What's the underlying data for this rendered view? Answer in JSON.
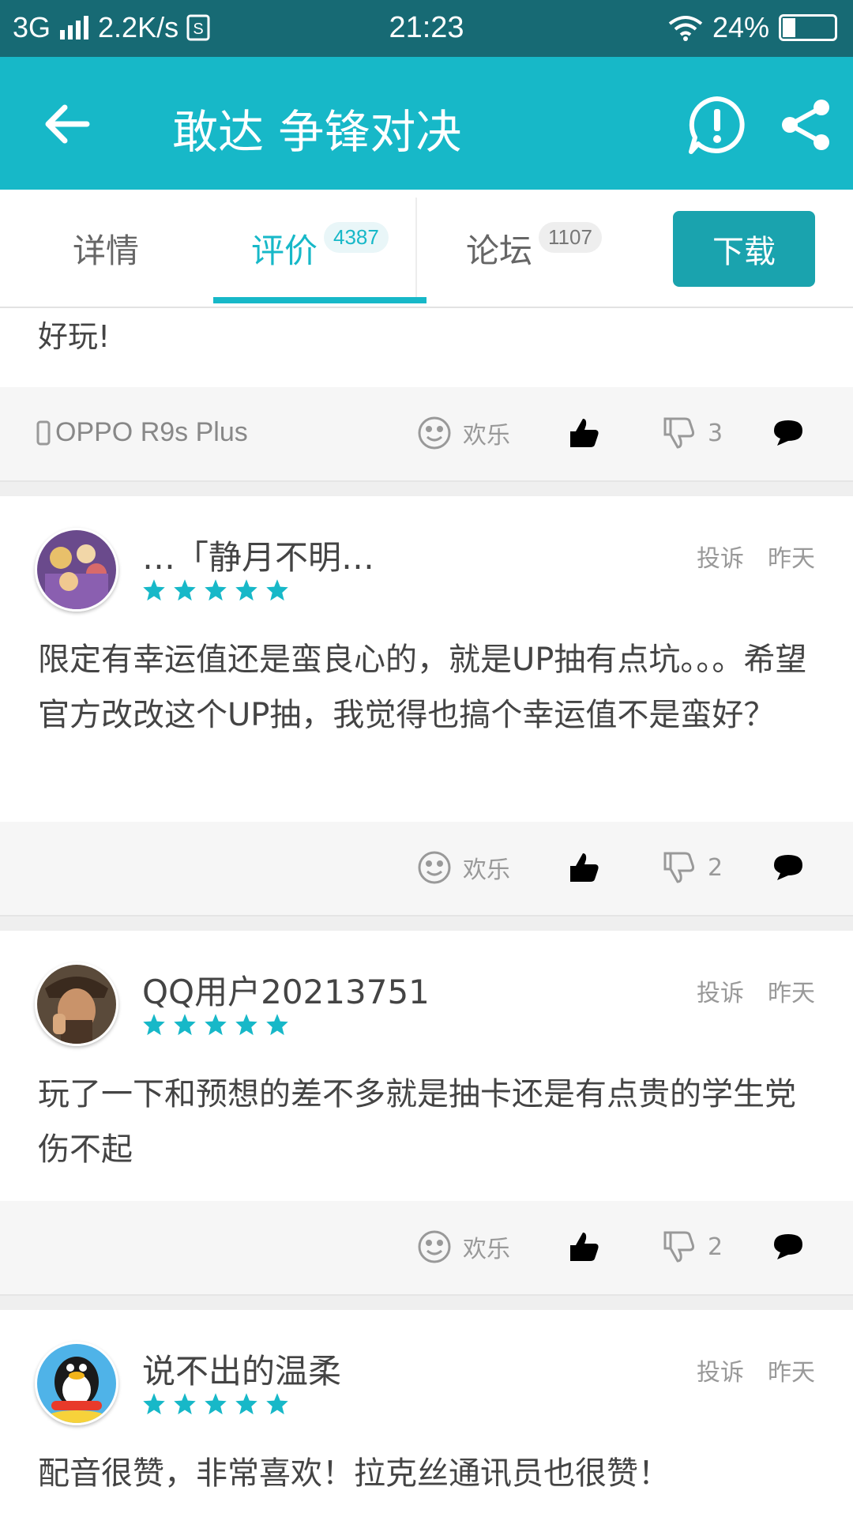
{
  "status": {
    "network": "3G",
    "speed": "2.2K/s",
    "time": "21:23",
    "battery": "24%",
    "battery_level": 0.24
  },
  "header": {
    "title": "敢达 争锋对决"
  },
  "tabs": [
    {
      "label": "详情"
    },
    {
      "label": "评价",
      "count": "4387"
    },
    {
      "label": "论坛",
      "count": "1107"
    }
  ],
  "download_label": "下载",
  "prev_review": {
    "text_tail": "好玩!",
    "device": "OPPO R9s Plus",
    "mood": "欢乐",
    "dislikes": "3"
  },
  "reviews": [
    {
      "user": "…「静月不明…",
      "rating": 5,
      "report": "投诉",
      "time": "昨天",
      "text": "限定有幸运值还是蛮良心的，就是UP抽有点坑。。。希望官方改改这个UP抽，我觉得也搞个幸运值不是蛮好？",
      "mood": "欢乐",
      "dislikes": "2",
      "avatar": "anime-group"
    },
    {
      "user": "QQ用户20213751",
      "rating": 5,
      "report": "投诉",
      "time": "昨天",
      "text": "玩了一下和预想的差不多就是抽卡还是有点贵的学生党伤不起",
      "mood": "欢乐",
      "dislikes": "2",
      "avatar": "pirate"
    },
    {
      "user": "说不出的温柔",
      "rating": 5,
      "report": "投诉",
      "time": "昨天",
      "text": "配音很赞，非常喜欢！拉克丝通讯员也很赞！",
      "avatar": "penguin"
    }
  ],
  "colors": {
    "accent": "#17b8c8",
    "statusbar": "#176a74",
    "download": "#1aa3ae"
  }
}
